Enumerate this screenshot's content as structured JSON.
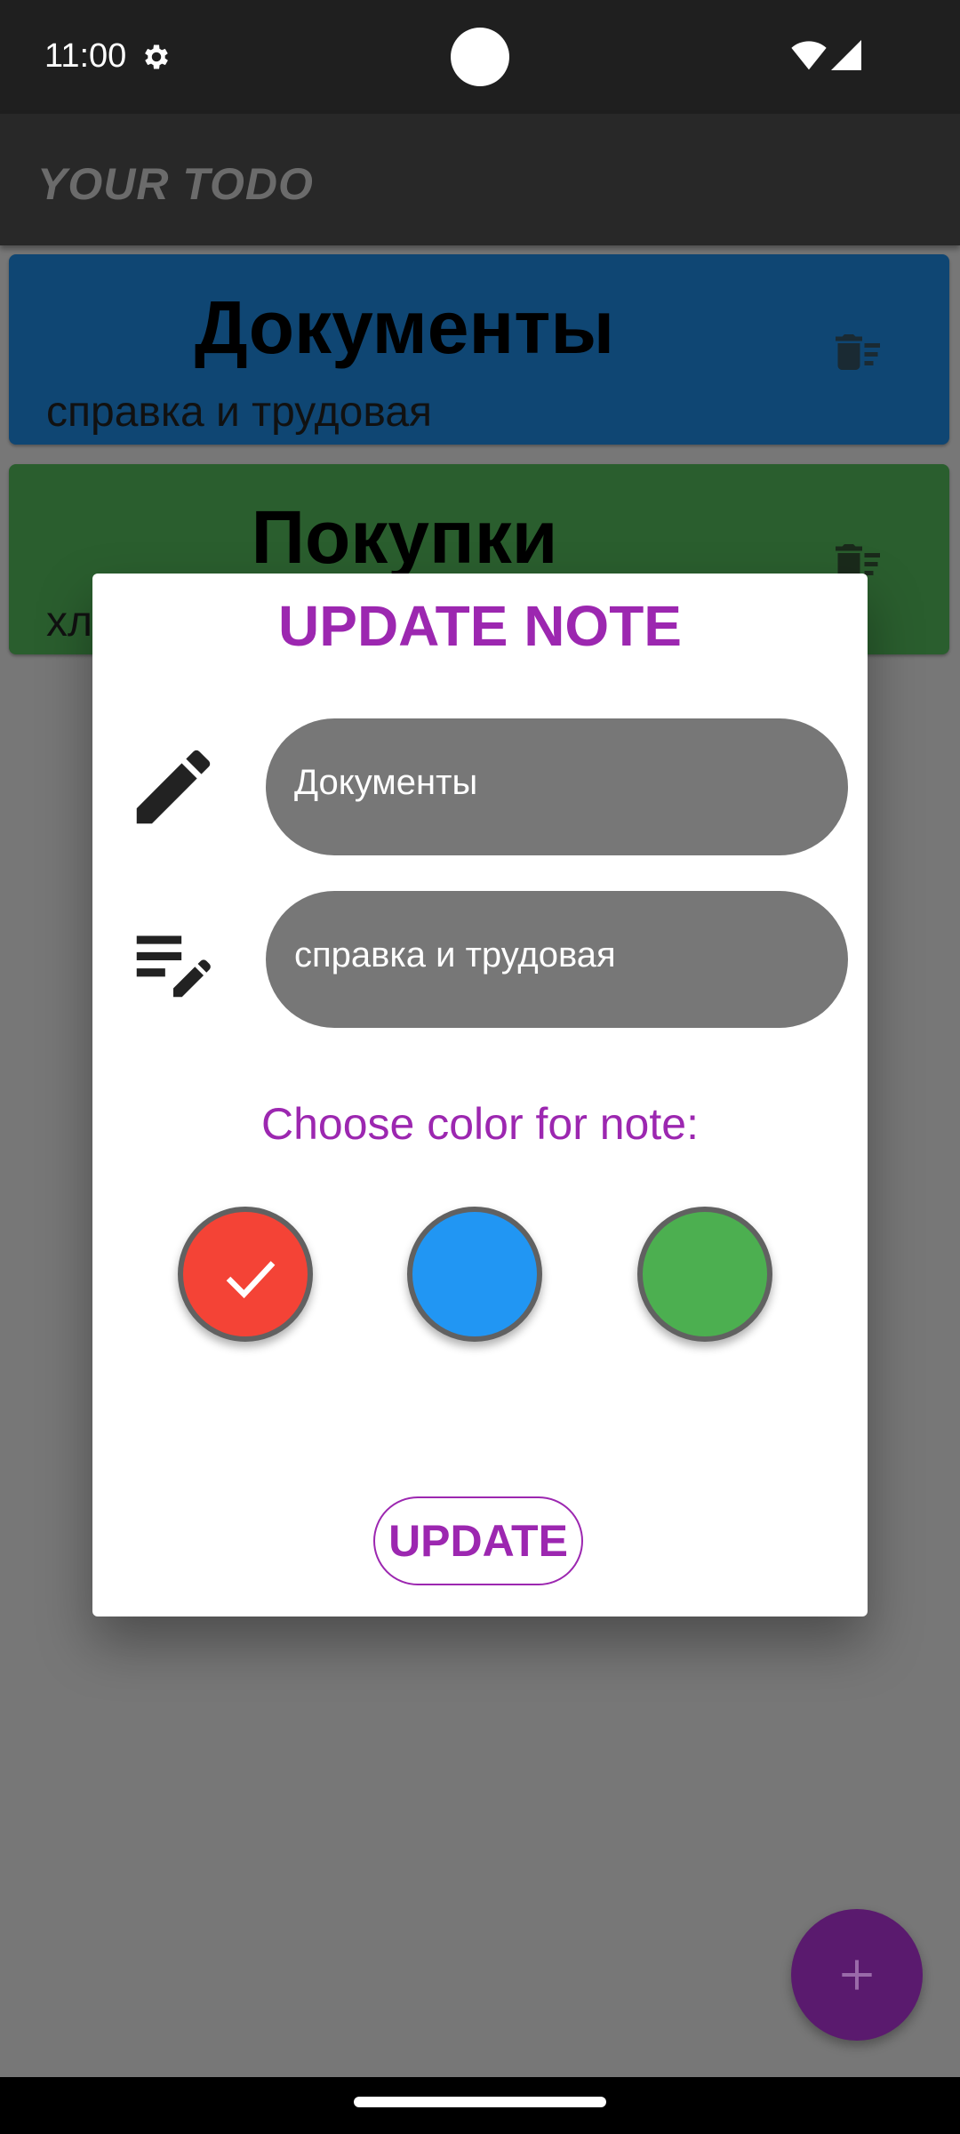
{
  "status_bar": {
    "time": "11:00",
    "icons": [
      "settings-gear-icon",
      "wifi-icon",
      "cellular-signal-icon"
    ]
  },
  "app_bar": {
    "title": "YOUR TODO"
  },
  "notes": [
    {
      "title": "Документы",
      "description": "справка и трудовая",
      "color": "#1565c0"
    },
    {
      "title": "Покупки",
      "description": "хл",
      "color": "#2e7d32"
    }
  ],
  "dialog": {
    "title": "UPDATE NOTE",
    "title_field": {
      "value": "Документы",
      "icon": "edit-pencil-icon"
    },
    "description_field": {
      "value": "справка и трудовая",
      "icon": "edit-note-icon"
    },
    "color_label": "Choose color for note:",
    "colors": [
      {
        "name": "red",
        "hex": "#f44336",
        "selected": true
      },
      {
        "name": "blue",
        "hex": "#2196f3",
        "selected": false
      },
      {
        "name": "green",
        "hex": "#4caf50",
        "selected": false
      }
    ],
    "update_button": "UPDATE"
  },
  "fab": {
    "icon": "plus-icon"
  },
  "colors": {
    "accent": "#9c27b0",
    "scrim": "#777777",
    "fab": "#5a1a6e"
  }
}
